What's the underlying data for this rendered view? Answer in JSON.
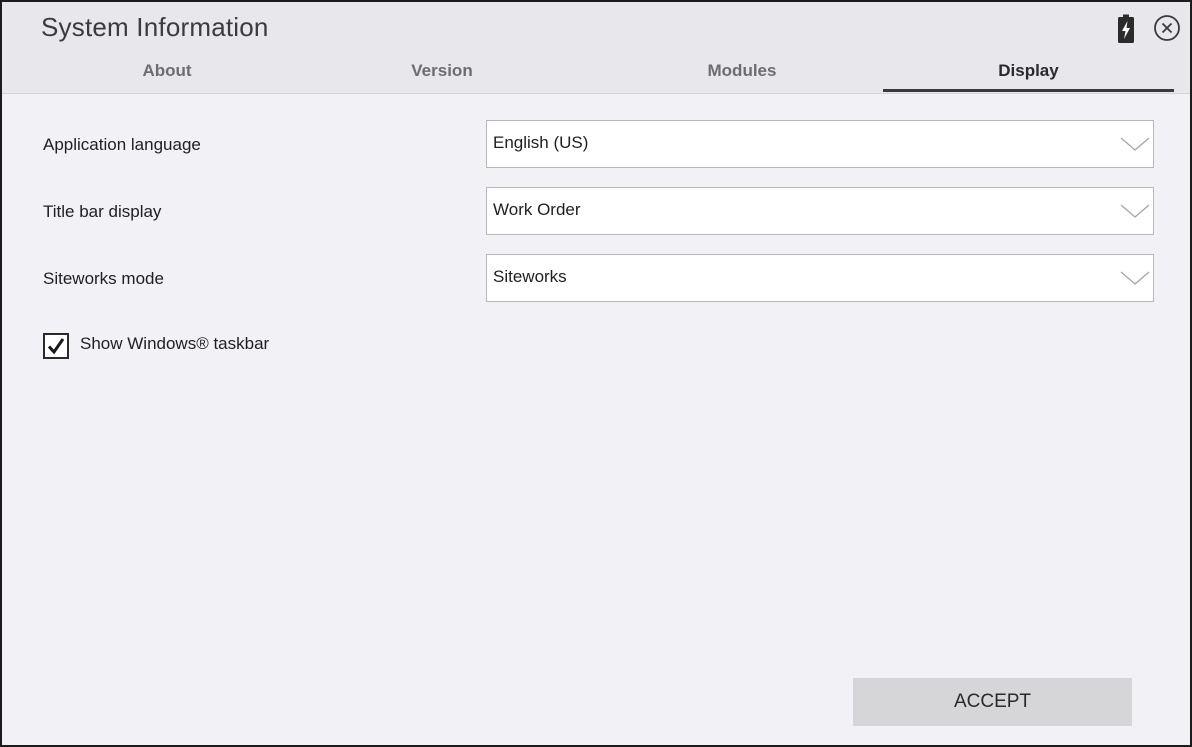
{
  "window": {
    "title": "System Information"
  },
  "header": {
    "icons": [
      "battery-charging-icon",
      "close-icon"
    ]
  },
  "tabs": [
    {
      "label": "About",
      "active": false
    },
    {
      "label": "Version",
      "active": false
    },
    {
      "label": "Modules",
      "active": false
    },
    {
      "label": "Display",
      "active": true
    }
  ],
  "settings": {
    "language": {
      "label": "Application language",
      "value": "English (US)"
    },
    "title_bar": {
      "label": "Title bar display",
      "value": "Work Order"
    },
    "siteworks_mode": {
      "label": "Siteworks mode",
      "value": "Siteworks"
    },
    "taskbar": {
      "label": "Show Windows® taskbar",
      "checked": true
    }
  },
  "footer": {
    "accept_label": "ACCEPT"
  },
  "colors": {
    "background": "#f2f1f6",
    "header": "#e8e7ec",
    "button": "#d6d6d9",
    "active_tab_underline": "#3a3a3a"
  }
}
